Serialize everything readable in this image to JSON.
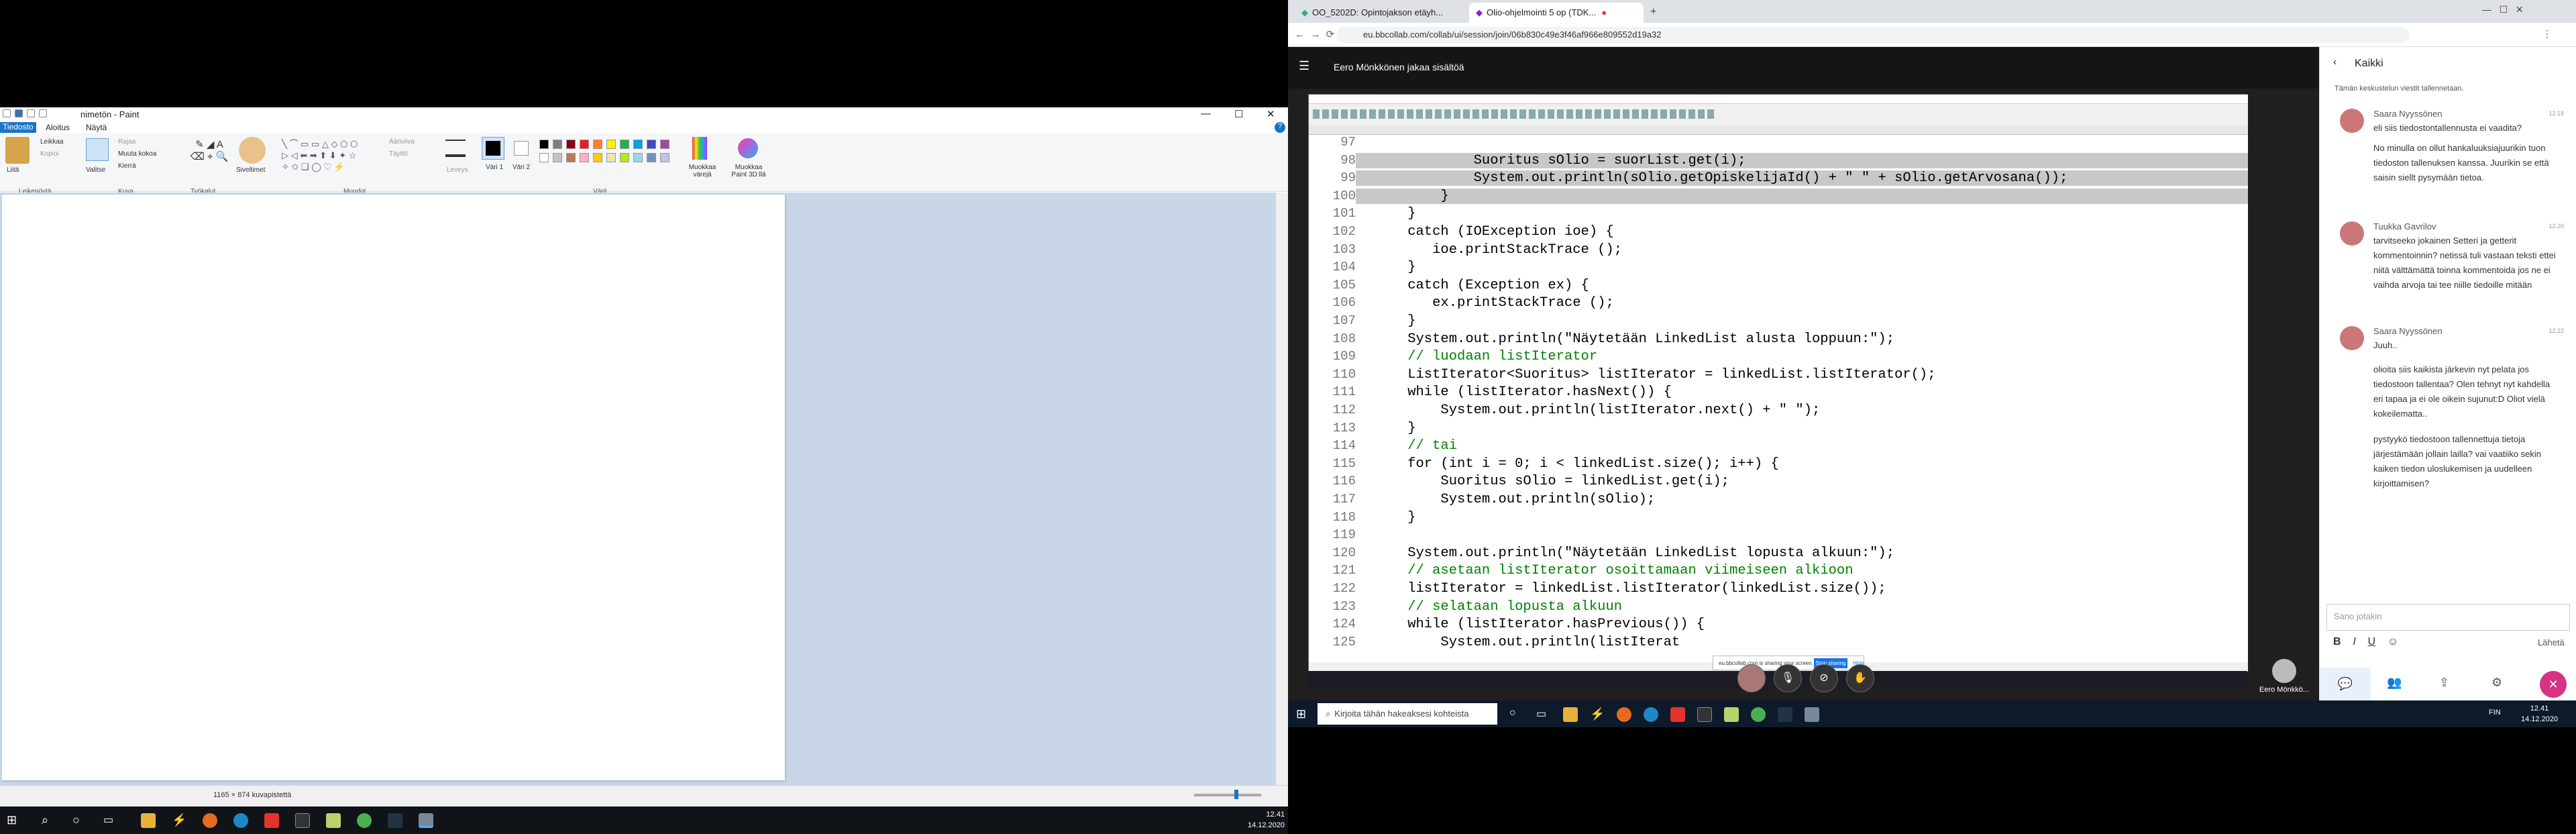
{
  "paint": {
    "title": "nimetön - Paint",
    "tabs": [
      "Tiedosto",
      "Aloitus",
      "Näytä"
    ],
    "ribbon": {
      "paste": "Liitä",
      "cut": "Leikkaa",
      "copy": "Kopioi",
      "select": "Valitse",
      "crop": "Rajaa",
      "resize": "Muuta kokoa",
      "rotate": "Kierrä",
      "brushes": "Siveltimet",
      "outline": "Ääriviiva",
      "fill": "Täyttö",
      "size": "Leveys",
      "color1": "Väri 1",
      "color2": "Väri 2",
      "edit_colors": "Muokkaa värejä",
      "paint3d": "Muokkaa Paint 3D:llä",
      "groups": [
        "Leikepöytä",
        "Kuva",
        "Työkalut",
        "Muodot",
        "Värit"
      ]
    },
    "status_size": "1165 × 874 kuvapistettä",
    "palette": [
      "#000000",
      "#7f7f7f",
      "#880015",
      "#ed1c24",
      "#ff7f27",
      "#fff200",
      "#22b14c",
      "#00a2e8",
      "#3f48cc",
      "#a349a4",
      "#ffffff",
      "#c3c3c3",
      "#b97a57",
      "#ffaec9",
      "#ffc90e",
      "#efe4b0",
      "#b5e61d",
      "#99d9ea",
      "#7092be",
      "#c8bfe7"
    ]
  },
  "taskbar_left": {
    "time": "12.41",
    "date": "14.12.2020"
  },
  "browser": {
    "tabs": [
      {
        "label": "OO_5202D: Opintojakson etäyh..."
      },
      {
        "label": "Olio-ohjelmointi 5 op (TDK..."
      }
    ],
    "url": "eu.bbcollab.com/collab/ui/session/join/06b830c49e3f46af966e809552d19a32"
  },
  "collab": {
    "sharing_title": "Eero Mönkkönen jakaa sisältöä",
    "share_notice": "eu.bbcollab.com is sharing your screen.",
    "stop_sharing": "Stop sharing",
    "hide": "Hide",
    "presenter": "Eero Mönkkö...",
    "code_lines": [
      {
        "n": "97",
        "t": ""
      },
      {
        "n": "98",
        "t": "            Suoritus sOlio = suorList.get(i);"
      },
      {
        "n": "99",
        "t": "            System.out.println(sOlio.getOpiskelijaId() + \" \" + sOlio.getArvosana());"
      },
      {
        "n": "100",
        "t": "        }"
      },
      {
        "n": "101",
        "t": "    }"
      },
      {
        "n": "102",
        "t": "    catch (IOException ioe) {"
      },
      {
        "n": "103",
        "t": "       ioe.printStackTrace ();"
      },
      {
        "n": "104",
        "t": "    }"
      },
      {
        "n": "105",
        "t": "    catch (Exception ex) {"
      },
      {
        "n": "106",
        "t": "       ex.printStackTrace ();"
      },
      {
        "n": "107",
        "t": "    }"
      },
      {
        "n": "108",
        "t": "    System.out.println(\"Näytetään LinkedList alusta loppuun:\");"
      },
      {
        "n": "109",
        "t": "    // luodaan listIterator"
      },
      {
        "n": "110",
        "t": "    ListIterator<Suoritus> listIterator = linkedList.listIterator();"
      },
      {
        "n": "111",
        "t": "    while (listIterator.hasNext()) {"
      },
      {
        "n": "112",
        "t": "        System.out.println(listIterator.next() + \" \");"
      },
      {
        "n": "113",
        "t": "    }"
      },
      {
        "n": "114",
        "t": "    // tai"
      },
      {
        "n": "115",
        "t": "    for (int i = 0; i < linkedList.size(); i++) {"
      },
      {
        "n": "116",
        "t": "        Suoritus sOlio = linkedList.get(i);"
      },
      {
        "n": "117",
        "t": "        System.out.println(sOlio);"
      },
      {
        "n": "118",
        "t": "    }"
      },
      {
        "n": "119",
        "t": ""
      },
      {
        "n": "120",
        "t": "    System.out.println(\"Näytetään LinkedList lopusta alkuun:\");"
      },
      {
        "n": "121",
        "t": "    // asetaan listIterator osoittamaan viimeiseen alkioon"
      },
      {
        "n": "122",
        "t": "    listIterator = linkedList.listIterator(linkedList.size());"
      },
      {
        "n": "123",
        "t": "    // selataan lopusta alkuun"
      },
      {
        "n": "124",
        "t": "    while (listIterator.hasPrevious()) {"
      },
      {
        "n": "125",
        "t": "        System.out.println(listIterat"
      }
    ]
  },
  "chat": {
    "header": "Kaikki",
    "notice": "Tämän keskustelun viestit tallennetaan.",
    "messages": [
      {
        "name": "Saara Nyyssönen",
        "time": "12.18",
        "text": "eli siis tiedostontallennusta ei vaadita?"
      },
      {
        "name": "",
        "time": "",
        "text": "No minulla on ollut hankaluuksiajuurikin tuon tiedoston tallenuksen kanssa. Juurikin se että saisin siellt pysymään tietoa."
      },
      {
        "name": "Tuukka Gavrilov",
        "time": "12.20",
        "text": "tarvitseeko jokainen Setteri ja getterit kommentoinnin? netissä tuli vastaan teksti ettei niitä välttämättä toinna kommentoida jos ne ei vaihda arvoja tai tee niille tiedoille mitään"
      },
      {
        "name": "Saara Nyyssönen",
        "time": "12.22",
        "text": "Juuh.."
      },
      {
        "name": "",
        "time": "",
        "text": "olioita siis kaikista järkevin nyt pelata jos tiedostoon tallentaa? Olen tehnyt nyt kahdella eri tapaa ja ei ole oikein sujunut:D Oliot vielä kokeilematta.."
      },
      {
        "name": "",
        "time": "",
        "text": "pystyykö tiedostoon tallennettuja tietoja järjestämään jollain lailla? vai vaatiiko sekin kaiken tiedon uloslukemisen ja uudelleen kirjoittamisen?"
      }
    ],
    "input_placeholder": "Sano jotakin",
    "format": [
      "B",
      "I",
      "U"
    ],
    "send": "Lähetä"
  },
  "taskbar_right": {
    "search_placeholder": "Kirjoita tähän hakeaksesi kohteista",
    "lang": "FIN",
    "time": "12.41",
    "date": "14.12.2020"
  }
}
